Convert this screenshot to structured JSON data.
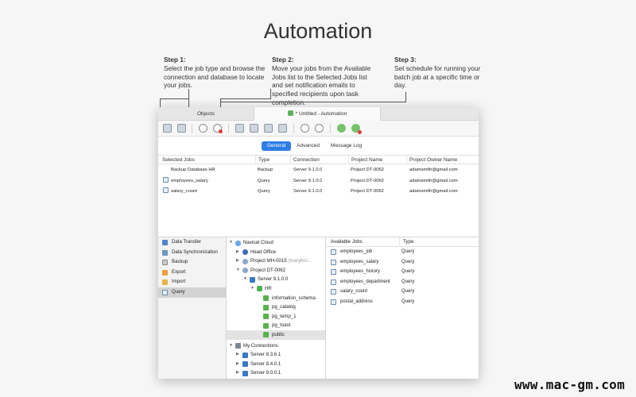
{
  "title": "Automation",
  "steps": [
    {
      "title": "Step 1:",
      "text": "Select the job type and browse the connection and database to locate your jobs."
    },
    {
      "title": "Step 2:",
      "text": "Move your jobs from the Available Jobs list to the Selected Jobs list and set notification emails to specified recipients upon task completion."
    },
    {
      "title": "Step 3:",
      "text": "Set schedule for running your batch job at a specific time or day."
    }
  ],
  "tabs": {
    "objects": "Objects",
    "automation": "* Untitled - Automation"
  },
  "toolbar_icons": [
    "new-job-icon",
    "save-icon",
    "clock-icon",
    "schedule-delete-icon",
    "move-right-icon",
    "move-left-icon",
    "search-icon",
    "filter-icon",
    "move-up-icon",
    "move-down-icon",
    "start-icon",
    "stop-icon"
  ],
  "segments": [
    "General",
    "Advanced",
    "Message Log"
  ],
  "jobs_table": {
    "headers": [
      "Selected Jobs",
      "Type",
      "Connection",
      "Project Name",
      "Project Owner Name"
    ],
    "rows": [
      {
        "job": "Backup Database HR",
        "type": "Backup",
        "connection": "Server 9.1.0.0",
        "project": "Project DT-0062",
        "owner": "adamsmith@gmail.com"
      },
      {
        "job": "employees_salary",
        "type": "Query",
        "connection": "Server 9.1.0.0",
        "project": "Project DT-0062",
        "owner": "adamsmith@gmail.com"
      },
      {
        "job": "salary_count",
        "type": "Query",
        "connection": "Server 9.1.0.0",
        "project": "Project DT-0062",
        "owner": "adamsmith@gmail.com"
      }
    ]
  },
  "job_types": [
    "Data Transfer",
    "Data Synchronization",
    "Backup",
    "Export",
    "Import",
    "Query"
  ],
  "tree": {
    "navicat_cloud": "Navicat Cloud",
    "head_office": "Head Office",
    "project_mh": "Project MH-0015",
    "project_mh_owner": "(marybro...",
    "project_dt": "Project DT-0062",
    "server": "Server 9.1.0.0",
    "hr": "HR",
    "schemas": [
      "information_schema",
      "pg_catalog",
      "pg_temp_1",
      "pg_toast",
      "public"
    ],
    "my_connections": "My Connections",
    "connections": [
      "Server 8.3.6.1",
      "Server 8.4.0.1",
      "Server 9.0.0.1"
    ]
  },
  "available_jobs": {
    "headers": [
      "Available Jobs",
      "Type"
    ],
    "rows": [
      {
        "name": "employees_job",
        "type": "Query"
      },
      {
        "name": "employees_salary",
        "type": "Query"
      },
      {
        "name": "employees_history",
        "type": "Query"
      },
      {
        "name": "employees_department",
        "type": "Query"
      },
      {
        "name": "salary_count",
        "type": "Query"
      },
      {
        "name": "postal_address",
        "type": "Query"
      }
    ]
  },
  "watermark": "www.mac-gm.com"
}
